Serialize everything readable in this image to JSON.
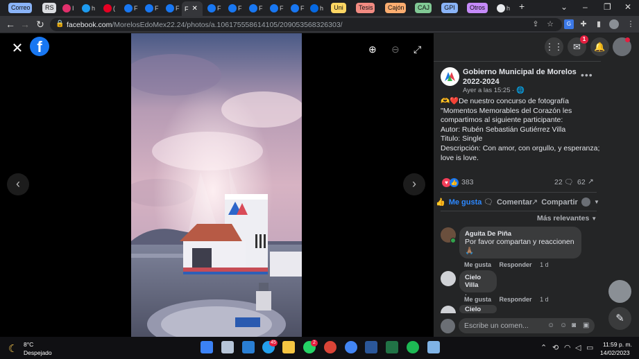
{
  "tabstrip": {
    "groups": [
      {
        "label": "Correo",
        "color": "#8ab4f8"
      },
      {
        "label": "RS",
        "color": "#dadce0"
      },
      {
        "label": "Uni",
        "color": "#fdd663"
      },
      {
        "label": "Tesis",
        "color": "#f28b82"
      },
      {
        "label": "Cajón",
        "color": "#fcad70"
      },
      {
        "label": "CAJ",
        "color": "#81c995"
      },
      {
        "label": "GPI",
        "color": "#8ab4f8"
      },
      {
        "label": "Otros",
        "color": "#c58af9"
      }
    ],
    "tabs": [
      {
        "label": "I",
        "icon": "instagram-icon",
        "color": "#e1306c"
      },
      {
        "label": "h",
        "icon": "twitter-icon",
        "color": "#1d9bf0"
      },
      {
        "label": "(",
        "icon": "pinterest-icon",
        "color": "#e60023"
      },
      {
        "label": "F",
        "icon": "facebook-icon",
        "color": "#1877f2"
      },
      {
        "label": "F",
        "icon": "facebook-icon",
        "color": "#1877f2"
      },
      {
        "label": "F",
        "icon": "facebook-icon",
        "color": "#1877f2"
      },
      {
        "label": "F",
        "icon": "facebook-icon",
        "color": "#1877f2"
      },
      {
        "label": "F",
        "icon": "facebook-icon",
        "color": "#1877f2"
      },
      {
        "label": "F",
        "icon": "facebook-icon",
        "color": "#1877f2"
      },
      {
        "label": "F",
        "icon": "facebook-icon",
        "color": "#1877f2"
      },
      {
        "label": "F",
        "icon": "facebook-icon",
        "color": "#1877f2"
      },
      {
        "label": "F",
        "icon": "facebook-icon",
        "color": "#1877f2"
      },
      {
        "label": "F",
        "icon": "facebook-icon",
        "color": "#1877f2"
      },
      {
        "label": "h",
        "icon": "meta-icon",
        "color": "#0668e1"
      },
      {
        "label": "h",
        "icon": "generic-icon",
        "color": "#5f6368"
      },
      {
        "label": "h",
        "icon": "generic-icon",
        "color": "#5f6368"
      },
      {
        "label": "h",
        "icon": "generic-icon",
        "color": "#5f6368"
      }
    ],
    "active_tab": {
      "label": "F",
      "icon": "facebook-icon"
    },
    "new_tab_label": "+"
  },
  "address_bar": {
    "url_host": "facebook.com",
    "url_path": "/MorelosEdoMex22.24/photos/a.106175558614105/209053568326303/"
  },
  "viewer": {
    "close_label": "✕",
    "logo_label": "f",
    "zoom_in_label": "⊕",
    "zoom_out_label": "⊖",
    "fullscreen_label": "⤢",
    "prev_label": "‹",
    "next_label": "›"
  },
  "panel": {
    "messenger_badge": "1",
    "page_name": "Gobierno Municipal de Morelos 2022-2024",
    "post_time": "Ayer a las 15:25 · ",
    "post_lines": [
      "🫶❤️De nuestro concurso de fotografía",
      "\"Momentos Memorables del Corazón les",
      "compartimos al siguiente participante:",
      "Autor: Rubén Sebastián Gutiérrez Villa",
      "Titulo: Single",
      "Descripción: Con amor, con orgullo, y esperanza;",
      "love is love."
    ],
    "reaction_count": "383",
    "comment_count": "22",
    "share_count": "62",
    "actions": {
      "like": "Me gusta",
      "comment": "Comentar",
      "share": "Compartir"
    },
    "sort_label": "Más relevantes",
    "comments": [
      {
        "author": "Aguita De Piña",
        "lines": [
          "Por favor compartan y reaccionen",
          "🙏🏽"
        ],
        "like": "Me gusta",
        "reply": "Responder",
        "age": "1 d"
      },
      {
        "author": "Cielo Villa",
        "lines": [
          "."
        ],
        "like": "Me gusta",
        "reply": "Responder",
        "age": "1 d"
      },
      {
        "author": "Cielo Villa",
        "lines": []
      }
    ],
    "composer_placeholder": "Escribe un comen..."
  },
  "taskbar": {
    "weather_temp": "8°C",
    "weather_desc": "Despejado",
    "badge_app1": "45",
    "badge_app2": "2",
    "time": "11:59 p. m.",
    "date": "14/02/2023"
  },
  "colors": {
    "facebook_blue": "#1877f2",
    "panel_bg": "#242526",
    "bubble_bg": "#3a3b3c",
    "like_blue": "#2d88ff"
  }
}
